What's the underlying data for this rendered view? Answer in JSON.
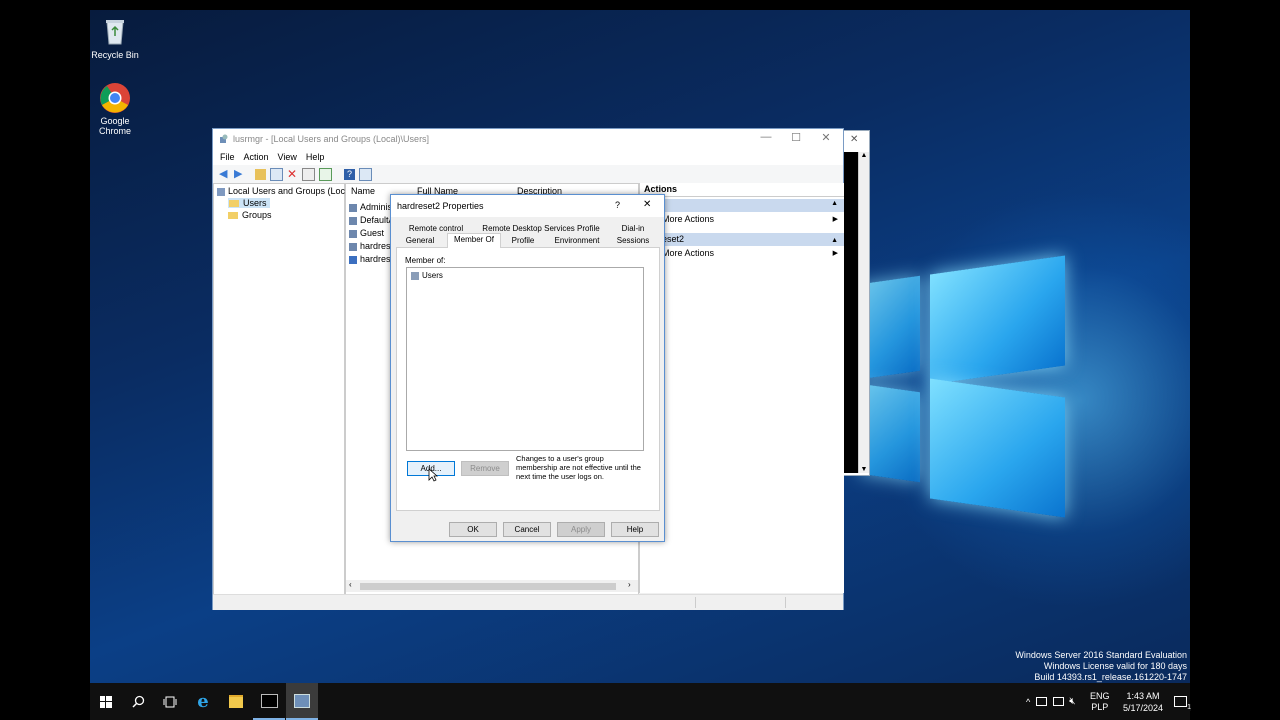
{
  "desktop": {
    "icons": [
      {
        "label": "Recycle Bin"
      },
      {
        "label_line1": "Google",
        "label_line2": "Chrome"
      }
    ],
    "watermark": {
      "line1": "Windows Server 2016 Standard Evaluation",
      "line2": "Windows License valid for 180 days",
      "line3": "Build 14393.rs1_release.161220-1747"
    }
  },
  "window": {
    "title": "lusrmgr - [Local Users and Groups (Local)\\Users]",
    "menu": [
      "File",
      "Action",
      "View",
      "Help"
    ],
    "tree": {
      "root": "Local Users and Groups (Local)",
      "children": [
        "Users",
        "Groups"
      ]
    },
    "list": {
      "columns": [
        "Name",
        "Full Name",
        "Description"
      ],
      "rows": [
        "Adminis",
        "DefaultA",
        "Guest",
        "hardrese",
        "hardrese"
      ]
    },
    "actions": {
      "header": "Actions",
      "section1_more": "More Actions",
      "section2_title": "eset2",
      "section2_more": "More Actions"
    }
  },
  "dialog": {
    "title": "hardreset2 Properties",
    "help_glyph": "?",
    "close_glyph": "✕",
    "tabs_row1": [
      "Remote control",
      "Remote Desktop Services Profile",
      "Dial-in"
    ],
    "tabs_row2": [
      "General",
      "Member Of",
      "Profile",
      "Environment",
      "Sessions"
    ],
    "member_of_label": "Member of:",
    "groups": [
      "Users"
    ],
    "add_label": "Add...",
    "remove_label": "Remove",
    "note": "Changes to a user's group membership are not effective until the next time the user logs on.",
    "buttons": {
      "ok": "OK",
      "cancel": "Cancel",
      "apply": "Apply",
      "help": "Help"
    }
  },
  "taskbar": {
    "language_line1": "ENG",
    "language_line2": "PLP",
    "time": "1:43 AM",
    "date": "5/17/2024",
    "notification_count": "1"
  }
}
